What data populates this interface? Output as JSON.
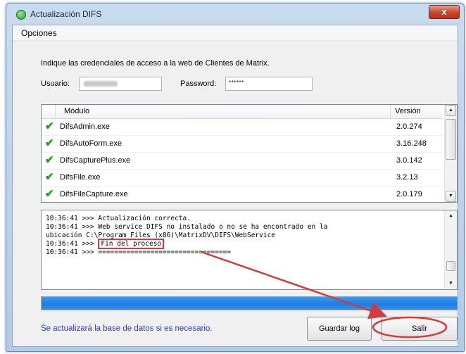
{
  "window": {
    "title": "Actualización DIFS",
    "close_glyph": "x"
  },
  "menu": {
    "opciones": "Opciones"
  },
  "credentials": {
    "instructions": "Indique las credenciales de acceso a la web de Clientes de Matrix.",
    "user_label": "Usuario:",
    "password_label": "Password:",
    "password_value": "******"
  },
  "modules": {
    "header_module": "Módulo",
    "header_version": "Versión",
    "rows": [
      {
        "name": "DifsAdmin.exe",
        "version": "2.0.274",
        "status_icon": "check-icon"
      },
      {
        "name": "DifsAutoForm.exe",
        "version": "3.16.248",
        "status_icon": "check-icon"
      },
      {
        "name": "DifsCapturePlus.exe",
        "version": "3.0.142",
        "status_icon": "check-icon"
      },
      {
        "name": "DifsFile.exe",
        "version": "3.2.13",
        "status_icon": "check-icon"
      },
      {
        "name": "DifsFileCapture.exe",
        "version": "2.0.179",
        "status_icon": "check-icon"
      }
    ]
  },
  "log": {
    "lines": [
      "10:36:41 >>> Actualización correcta.",
      "10:36:41 >>> Web service DIFS no instalado o no se ha encontrado en la",
      "ubicación C:\\Program Files (x86)\\MatrixDV\\DIFS\\WebService",
      "10:36:41 >>> ",
      "10:36:41 >>> ================================="
    ],
    "highlight_text": "Fin del proceso"
  },
  "progress": {
    "value": 1.0
  },
  "footer": {
    "message": "Se actualizará la base de datos si es necesario.",
    "save_log_label": "Guardar log",
    "exit_label": "Salir"
  },
  "colors": {
    "annotation_red": "#d23c3c",
    "progress_blue": "#1f7de0",
    "footer_text_blue": "#2a3ad6",
    "check_green": "#1f9b1f"
  }
}
